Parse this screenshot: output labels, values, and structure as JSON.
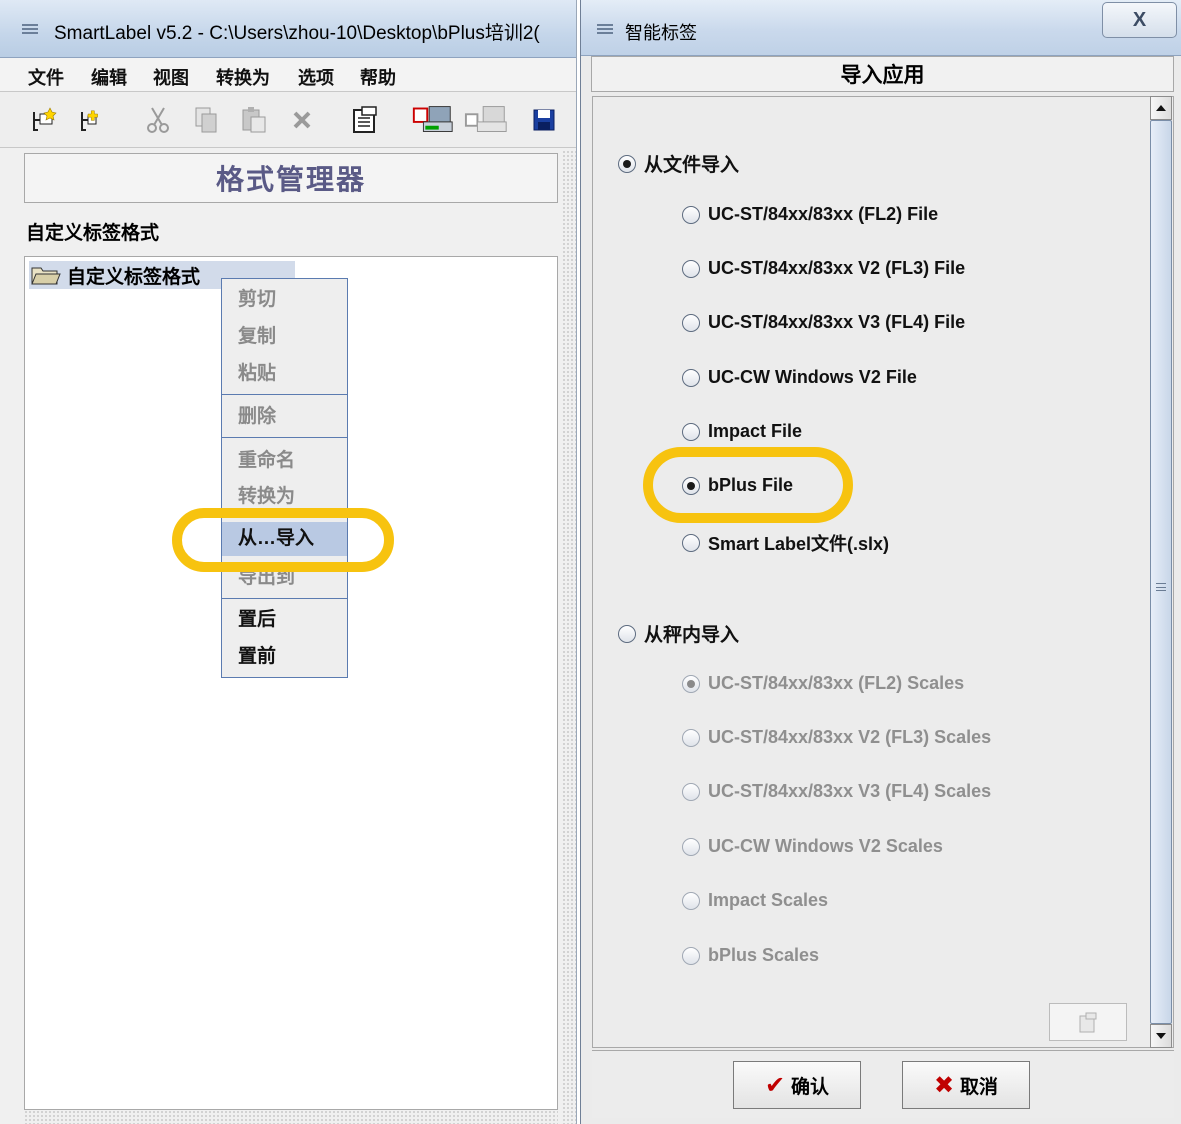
{
  "left_window": {
    "title": "SmartLabel v5.2 - C:\\Users\\zhou-10\\Desktop\\bPlus培训2(",
    "menu": [
      "文件",
      "编辑",
      "视图",
      "转换为",
      "选项",
      "帮助"
    ],
    "toolbar_icons": [
      "new-label-icon",
      "new-folder-icon",
      "cut-icon",
      "copy-icon",
      "paste-icon",
      "delete-icon",
      "properties-icon",
      "transfer-to-scale-icon",
      "transfer-from-scale-icon",
      "save-icon"
    ],
    "format_manager_title": "格式管理器",
    "subtitle": "自定义标签格式",
    "tree_node": "自定义标签格式",
    "context_menu": {
      "cut": "剪切",
      "copy": "复制",
      "paste": "粘贴",
      "delete": "删除",
      "rename": "重命名",
      "convert": "转换为",
      "import_from": "从…导入",
      "export_to": "导出到",
      "move_back": "置后",
      "move_front": "置前"
    }
  },
  "dialog": {
    "title": "智能标签",
    "header": "导入应用",
    "import_from_file": {
      "label": "从文件导入",
      "selected": true,
      "options": [
        "UC-ST/84xx/83xx (FL2) File",
        "UC-ST/84xx/83xx V2 (FL3) File",
        "UC-ST/84xx/83xx V3 (FL4) File",
        "UC-CW Windows V2 File",
        "Impact File",
        "bPlus File",
        "Smart Label文件(.slx)"
      ],
      "selected_option": "bPlus File"
    },
    "import_from_scale": {
      "label": "从秤内导入",
      "selected": false,
      "options": [
        "UC-ST/84xx/83xx (FL2) Scales",
        "UC-ST/84xx/83xx V2 (FL3) Scales",
        "UC-ST/84xx/83xx V3 (FL4) Scales",
        "UC-CW Windows V2 Scales",
        "Impact Scales",
        "bPlus Scales"
      ],
      "selected_option": "UC-ST/84xx/83xx (FL2) Scales"
    },
    "ok_button": "确认",
    "cancel_button": "取消",
    "close_glyph": "X"
  },
  "colors": {
    "highlight_ring": "#f7c30f",
    "menu_hover": "#b9c9e3",
    "disabled_text": "#8a8a8a",
    "fm_title": "#5a5a86"
  }
}
